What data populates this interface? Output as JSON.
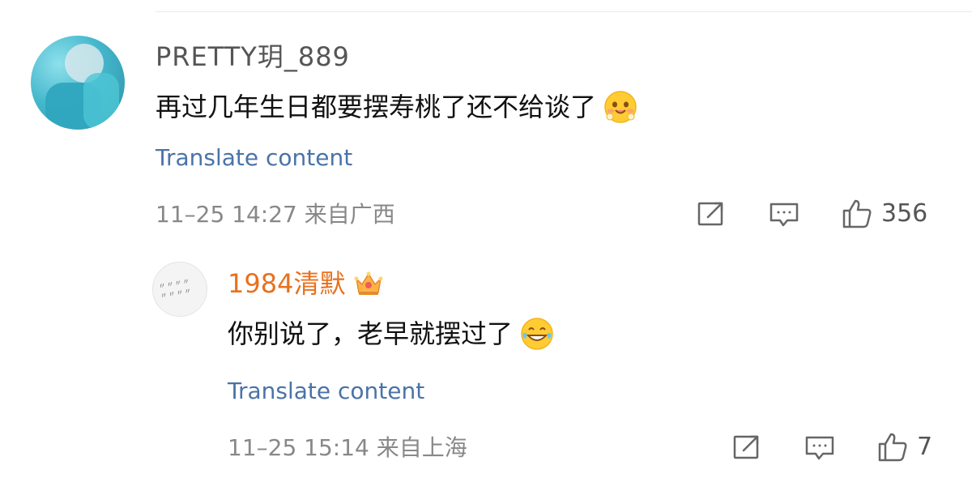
{
  "comment": {
    "username": "PRETTY玥_889",
    "text": "再过几年生日都要摆寿桃了还不给谈了",
    "emoji": "blushing-face-icon",
    "translate": "Translate content",
    "meta": "11–25 14:27 来自广西",
    "likes": "356"
  },
  "reply": {
    "username": "1984清默",
    "badge": "crown-icon",
    "text": "你别说了，老早就摆过了",
    "emoji": "laughing-tears-icon",
    "translate": "Translate content",
    "meta": "11–25 15:14 来自上海",
    "likes": "7"
  },
  "colors": {
    "link": "#4a73a8",
    "username_highlight": "#e8711d",
    "meta": "#888888",
    "divider": "#ebebeb"
  }
}
